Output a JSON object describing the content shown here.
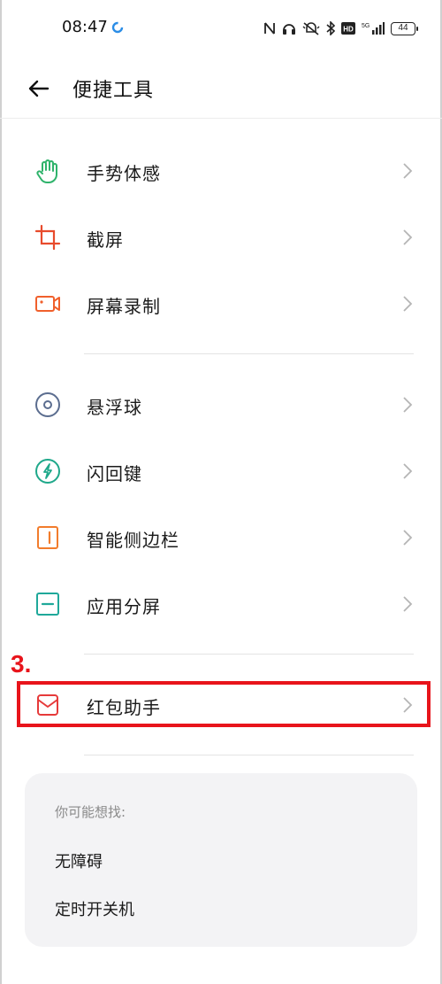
{
  "status_bar": {
    "time": "08:47",
    "battery": "44",
    "icons": [
      "nfc-icon",
      "headset-icon",
      "mute-icon",
      "bluetooth-icon",
      "hd-icon",
      "signal-5g-icon",
      "battery-icon"
    ],
    "network_label": "5G",
    "hd_label": "HD"
  },
  "header": {
    "title": "便捷工具",
    "back_icon": "back-arrow-icon"
  },
  "groups": [
    {
      "items": [
        {
          "label": "手势体感",
          "icon": "gesture-hand-icon",
          "color": "#2fb36b"
        },
        {
          "label": "截屏",
          "icon": "crop-icon",
          "color": "#e84b2c"
        },
        {
          "label": "屏幕录制",
          "icon": "video-camera-icon",
          "color": "#f0602c"
        }
      ]
    },
    {
      "items": [
        {
          "label": "悬浮球",
          "icon": "floating-ball-icon",
          "color": "#5b6d8f"
        },
        {
          "label": "闪回键",
          "icon": "flash-bolt-icon",
          "color": "#1fa88a"
        },
        {
          "label": "智能侧边栏",
          "icon": "sidebar-icon",
          "color": "#f27c2c"
        },
        {
          "label": "应用分屏",
          "icon": "split-screen-icon",
          "color": "#1fa89a"
        }
      ]
    },
    {
      "items": [
        {
          "label": "红包助手",
          "icon": "red-envelope-icon",
          "color": "#e63a3a"
        }
      ]
    }
  ],
  "annotation": {
    "step": "3.",
    "color": "#e8141b"
  },
  "suggestions": {
    "title": "你可能想找:",
    "items": [
      "无障碍",
      "定时开关机"
    ]
  },
  "colors": {
    "chevron": "#b5b5b5",
    "divider": "#e4e4e4",
    "card_bg": "#f3f3f5"
  }
}
